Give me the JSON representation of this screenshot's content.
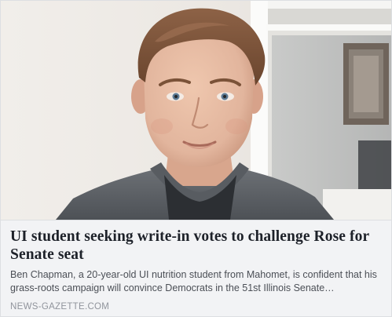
{
  "link_preview": {
    "image": {
      "subject": "portrait of young man with short brown hair wearing a grey knit sweater, indoors by a window",
      "colors": {
        "wall": "#ece8e3",
        "window_frame": "#f7f7f5",
        "window_shade": "#a4a7a8",
        "frame_on_wall": "#6f645b",
        "hair": "#7a5238",
        "skin": "#e2b59d",
        "sweater": "#5d6166",
        "shirt": "#2c2f33"
      }
    },
    "headline": "UI student seeking write-in votes to challenge Rose for Senate seat",
    "description": "Ben Chapman, a 20-year-old UI nutrition student from Mahomet, is confident that his grass-roots campaign will convince Democrats in the 51st Illinois Senate…",
    "domain": "NEWS-GAZETTE.COM"
  }
}
